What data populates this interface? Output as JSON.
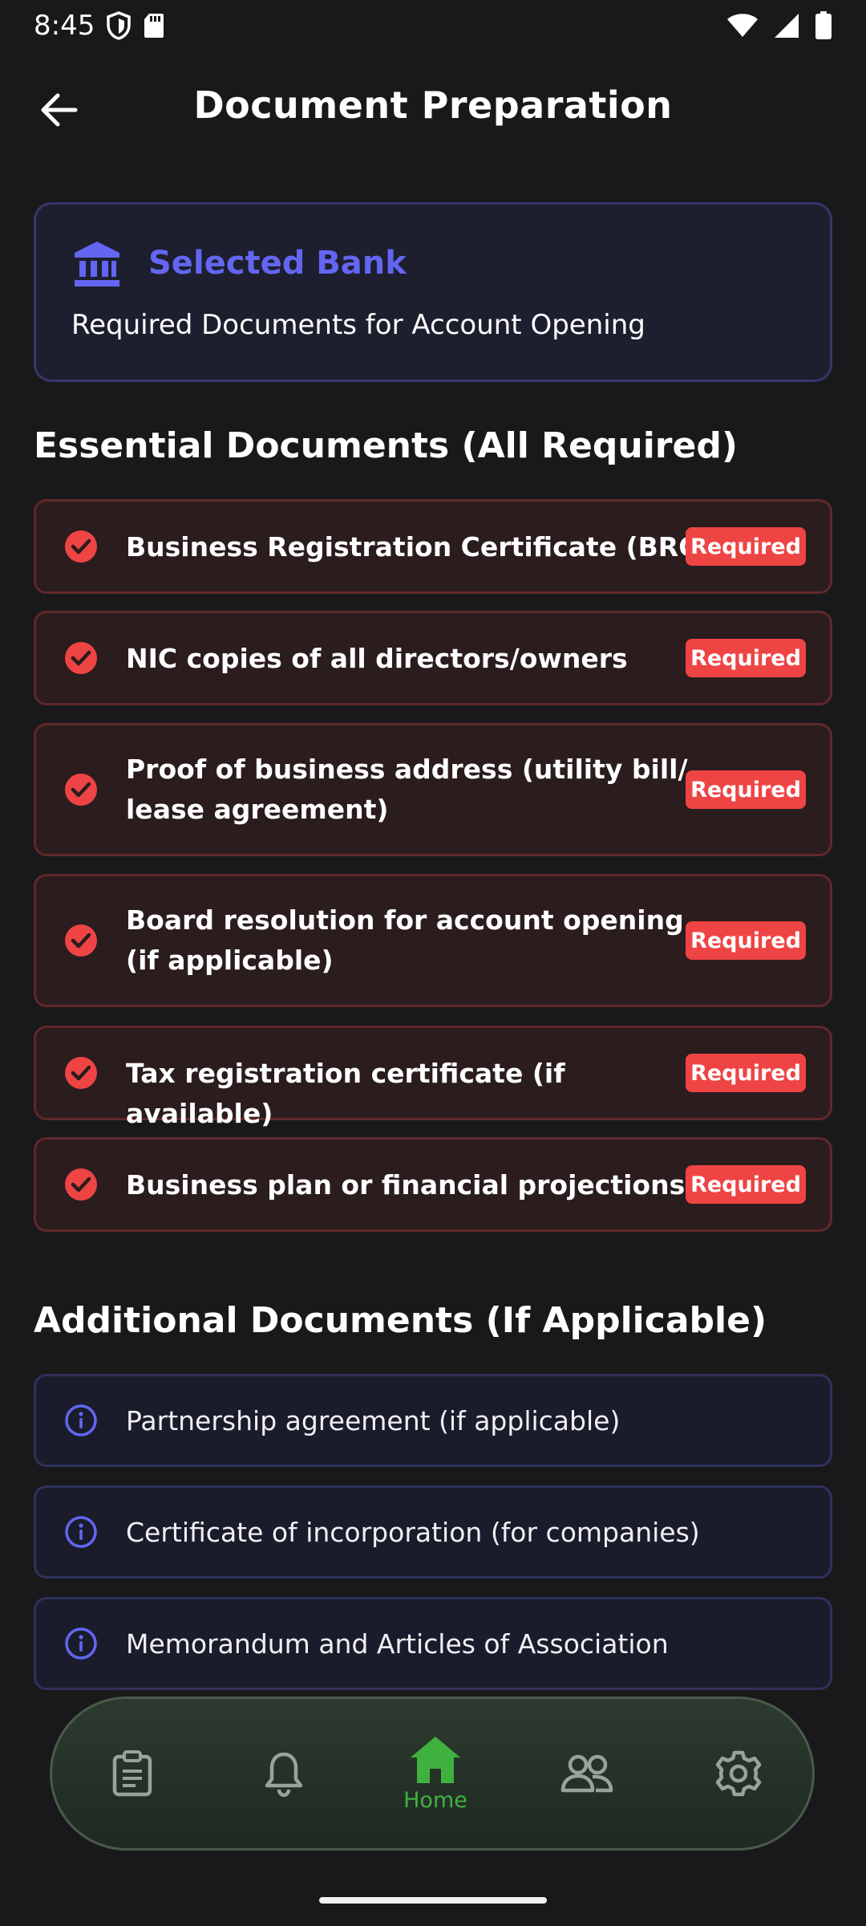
{
  "status_bar": {
    "time": "8:45"
  },
  "header": {
    "title": "Document Preparation"
  },
  "bank_card": {
    "title": "Selected Bank",
    "subtitle": "Required Documents for Account Opening"
  },
  "essential_section": {
    "heading": "Essential Documents (All Required)",
    "badge_label": "Required",
    "items": [
      {
        "label": "Business Registration Certificate (BRC)"
      },
      {
        "label": "NIC copies of all directors/owners"
      },
      {
        "label": "Proof of business address (utility bill/ lease agreement)"
      },
      {
        "label": "Board resolution for account opening (if applicable)"
      },
      {
        "label": "Tax registration certificate (if available)"
      },
      {
        "label": "Business plan or financial projections"
      }
    ]
  },
  "additional_section": {
    "heading": "Additional Documents (If Applicable)",
    "items": [
      {
        "label": "Partnership agreement (if applicable)"
      },
      {
        "label": "Certificate of incorporation (for companies)"
      },
      {
        "label": "Memorandum and Articles of Association"
      }
    ]
  },
  "bottom_nav": {
    "active_label": "Home",
    "items": [
      {
        "icon": "clipboard-icon"
      },
      {
        "icon": "bell-icon"
      },
      {
        "icon": "home-icon"
      },
      {
        "icon": "people-icon"
      },
      {
        "icon": "gear-icon"
      }
    ]
  },
  "colors": {
    "background": "#19191b",
    "accent_indigo": "#6366f1",
    "required_red": "#ef4444",
    "nav_active_green": "#3fb13f"
  }
}
